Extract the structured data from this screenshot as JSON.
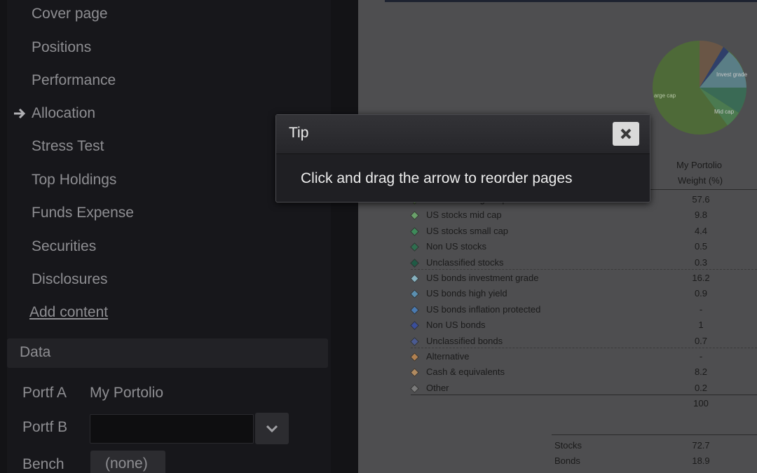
{
  "sidebar": {
    "pages": [
      {
        "label": "Cover page"
      },
      {
        "label": "Positions"
      },
      {
        "label": "Performance"
      },
      {
        "label": "Allocation"
      },
      {
        "label": "Stress Test"
      },
      {
        "label": "Top Holdings"
      },
      {
        "label": "Funds Expense"
      },
      {
        "label": "Securities"
      },
      {
        "label": "Disclosures"
      }
    ],
    "add_content": "Add content",
    "data_header": "Data",
    "portf_a_label": "Portf A",
    "portf_a_value": "My Portolio",
    "portf_b_label": "Portf B",
    "portf_b_value": "",
    "bench_label": "Bench",
    "bench_value": "(none)"
  },
  "preview": {
    "col_portfolio": "My Portolio",
    "col_weight": "Weight (%)",
    "pie_labels": [
      "Invest grade",
      "arge cap",
      "Mid cap"
    ],
    "rows": [
      {
        "label": "US stocks large cap",
        "value": "57.6",
        "color": "#5d8a3a"
      },
      {
        "label": "US stocks mid cap",
        "value": "9.8",
        "color": "#6aa06a"
      },
      {
        "label": "US stocks small cap",
        "value": "4.4",
        "color": "#3e8a5a"
      },
      {
        "label": "Non US stocks",
        "value": "0.5",
        "color": "#2f6e4f"
      },
      {
        "label": "Unclassified stocks",
        "value": "0.3",
        "color": "#1f5a45"
      },
      {
        "label": "US bonds investment grade",
        "value": "16.2",
        "color": "#86b0be"
      },
      {
        "label": "US bonds high yield",
        "value": "0.9",
        "color": "#5b8fb0"
      },
      {
        "label": "US bonds inflation protected",
        "value": "-",
        "color": "#4a7ab0"
      },
      {
        "label": "Non US bonds",
        "value": "1",
        "color": "#3a4e9a"
      },
      {
        "label": "Unclassified bonds",
        "value": "0.7",
        "color": "#4a5a90"
      },
      {
        "label": "Alternative",
        "value": "-",
        "color": "#b08050"
      },
      {
        "label": "Cash & equivalents",
        "value": "8.2",
        "color": "#b08a60"
      },
      {
        "label": "Other",
        "value": "0.2",
        "color": "#7a7a7a"
      }
    ],
    "total": "100",
    "summary": [
      {
        "label": "Stocks",
        "value": "72.7"
      },
      {
        "label": "Bonds",
        "value": "18.9"
      }
    ]
  },
  "tip": {
    "title": "Tip",
    "message": "Click and drag the arrow to reorder pages",
    "close_icon": "close-icon"
  }
}
